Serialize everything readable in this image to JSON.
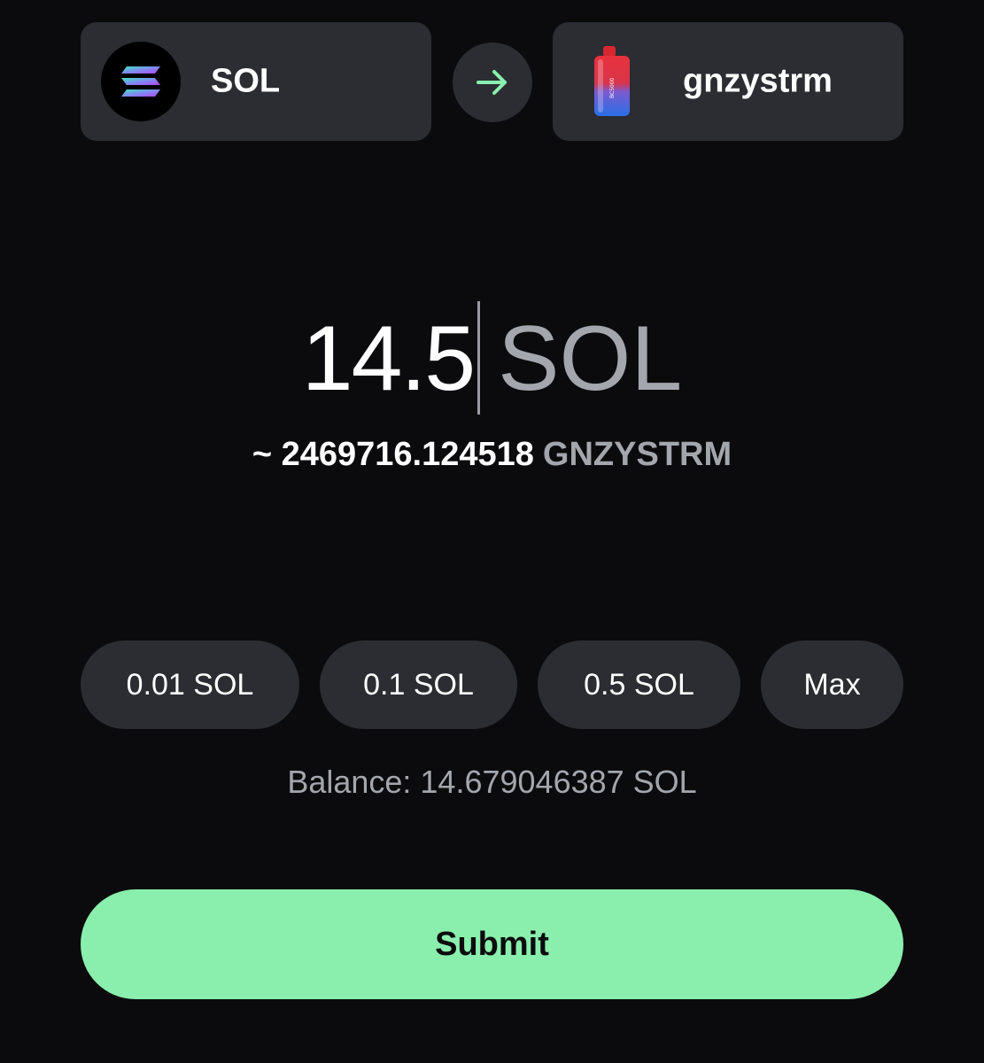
{
  "colors": {
    "background": "#0b0b0d",
    "card": "#2b2d33",
    "accent": "#8aefad",
    "muted_text": "#a4a6ad"
  },
  "from_token": {
    "symbol": "SOL",
    "icon": "solana-logo-icon"
  },
  "swap_direction_icon": "arrow-right-icon",
  "to_token": {
    "symbol": "gnzystrm",
    "icon": "vape-device-icon",
    "device_text": "BC5000"
  },
  "amount": {
    "value": "14.5",
    "unit": "SOL"
  },
  "estimate": {
    "prefix": "~",
    "value": "2469716.124518",
    "symbol": "GNZYSTRM"
  },
  "presets": [
    {
      "label": "0.01 SOL"
    },
    {
      "label": "0.1 SOL"
    },
    {
      "label": "0.5 SOL"
    },
    {
      "label": "Max"
    }
  ],
  "balance": {
    "text": "Balance: 14.679046387 SOL"
  },
  "submit": {
    "label": "Submit"
  }
}
